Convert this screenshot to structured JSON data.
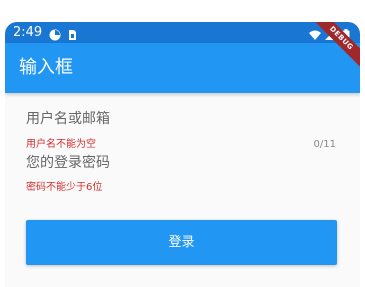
{
  "status_bar": {
    "time": "2:49",
    "icons": [
      "app-notification-icon",
      "sim-card-icon",
      "wifi-icon",
      "signal-icon",
      "battery-icon"
    ]
  },
  "app_bar": {
    "title": "输入框",
    "debug_banner": "DEBUG"
  },
  "form": {
    "username": {
      "placeholder": "用户名或邮箱",
      "value": "",
      "error": "用户名不能为空",
      "counter": "0/11"
    },
    "password": {
      "placeholder": "您的登录密码",
      "value": "",
      "error": "密码不能少于6位"
    },
    "submit_label": "登录"
  },
  "colors": {
    "status_bar": "#1976d2",
    "primary": "#2196f3",
    "error": "#d32f2f",
    "debug_banner": "#a0282d"
  }
}
